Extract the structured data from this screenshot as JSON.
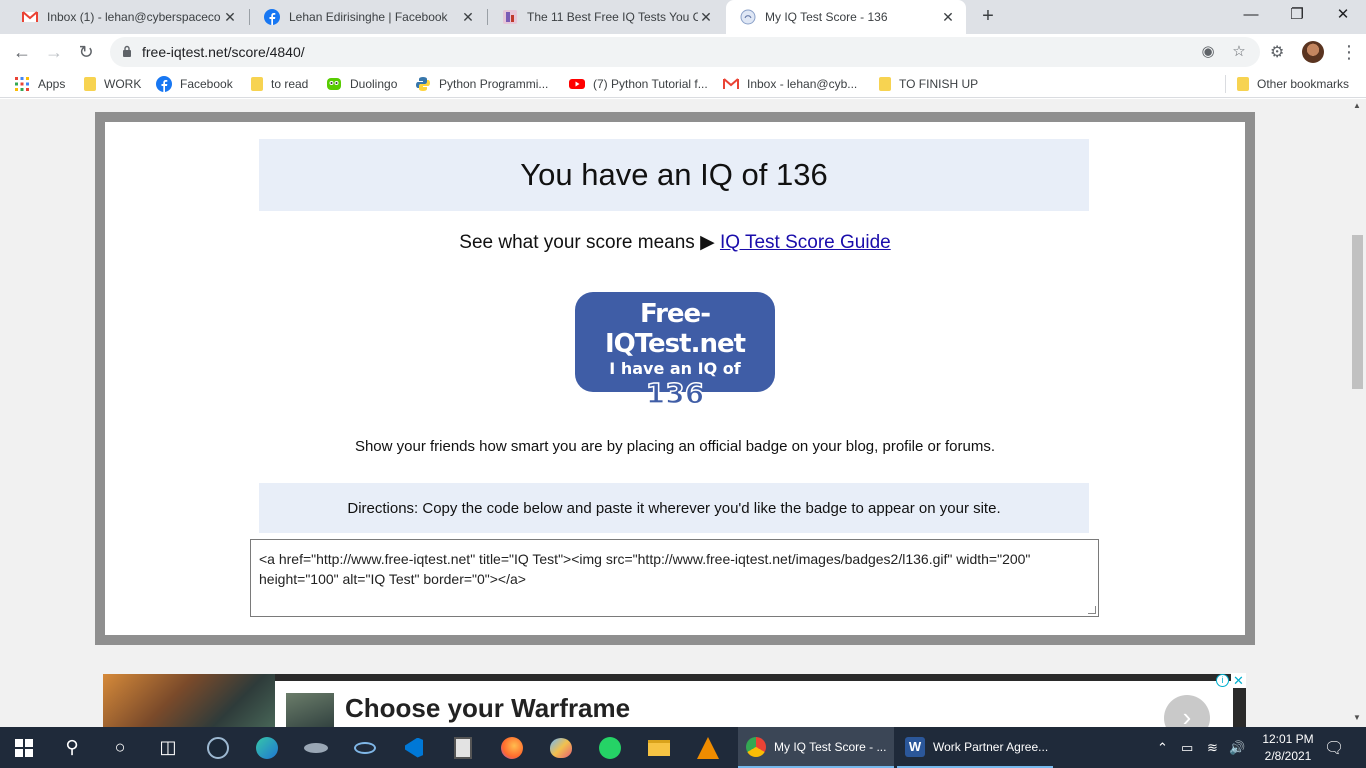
{
  "browser": {
    "tabs": [
      {
        "title": "Inbox (1) - lehan@cyberspaceco",
        "favicon": "gmail-icon",
        "active": false
      },
      {
        "title": "Lehan Edirisinghe | Facebook",
        "favicon": "facebook-icon",
        "active": false
      },
      {
        "title": "The 11 Best Free IQ Tests You Ca",
        "favicon": "article-icon",
        "active": false
      },
      {
        "title": "My IQ Test Score - 136",
        "favicon": "iqtest-icon",
        "active": true
      }
    ],
    "new_tab_symbol": "+",
    "url": "free-iqtest.net/score/4840/",
    "bookmarks": [
      {
        "label": "Apps",
        "icon": "apps-grid-icon"
      },
      {
        "label": "WORK",
        "icon": "folder-icon"
      },
      {
        "label": "Facebook",
        "icon": "facebook-icon"
      },
      {
        "label": "to read",
        "icon": "folder-icon"
      },
      {
        "label": "Duolingo",
        "icon": "duolingo-icon"
      },
      {
        "label": "Python Programmi...",
        "icon": "python-icon"
      },
      {
        "label": "(7) Python Tutorial f...",
        "icon": "youtube-icon"
      },
      {
        "label": "Inbox - lehan@cyb...",
        "icon": "gmail-icon"
      },
      {
        "label": "TO FINISH UP",
        "icon": "folder-icon"
      }
    ],
    "other_bookmarks": "Other bookmarks"
  },
  "page": {
    "heading": "You have an IQ of 136",
    "guide_prefix": "See what your score means ▶",
    "guide_link": "IQ Test Score Guide",
    "badge": {
      "site": "Free-IQTest.net",
      "line2": "I have an IQ of",
      "score": "136"
    },
    "share_text": "Show your friends how smart you are by placing an official badge on your blog, profile or forums.",
    "directions": "Directions: Copy the code below and paste it wherever you'd like the badge to appear on your site.",
    "embed_code": "<a href=\"http://www.free-iqtest.net\" title=\"IQ Test\"><img src=\"http://www.free-iqtest.net/images/badges2/l136.gif\" width=\"200\" height=\"100\" alt=\"IQ Test\" border=\"0\"></a>"
  },
  "ad": {
    "title": "Choose your Warframe",
    "info_symbol": "i",
    "close_symbol": "✕",
    "next_symbol": "›"
  },
  "taskbar": {
    "apps": [
      {
        "label": "My IQ Test Score - ...",
        "icon": "chrome-icon",
        "active": true
      },
      {
        "label": "Work Partner Agree...",
        "icon": "word-icon",
        "active": false
      }
    ],
    "time": "12:01 PM",
    "date": "2/8/2021"
  },
  "colors": {
    "badge_blue": "#3f5da6",
    "heading_bg": "#e8eef8",
    "link": "#1a0dab",
    "frame_border": "#8f8f8f"
  }
}
